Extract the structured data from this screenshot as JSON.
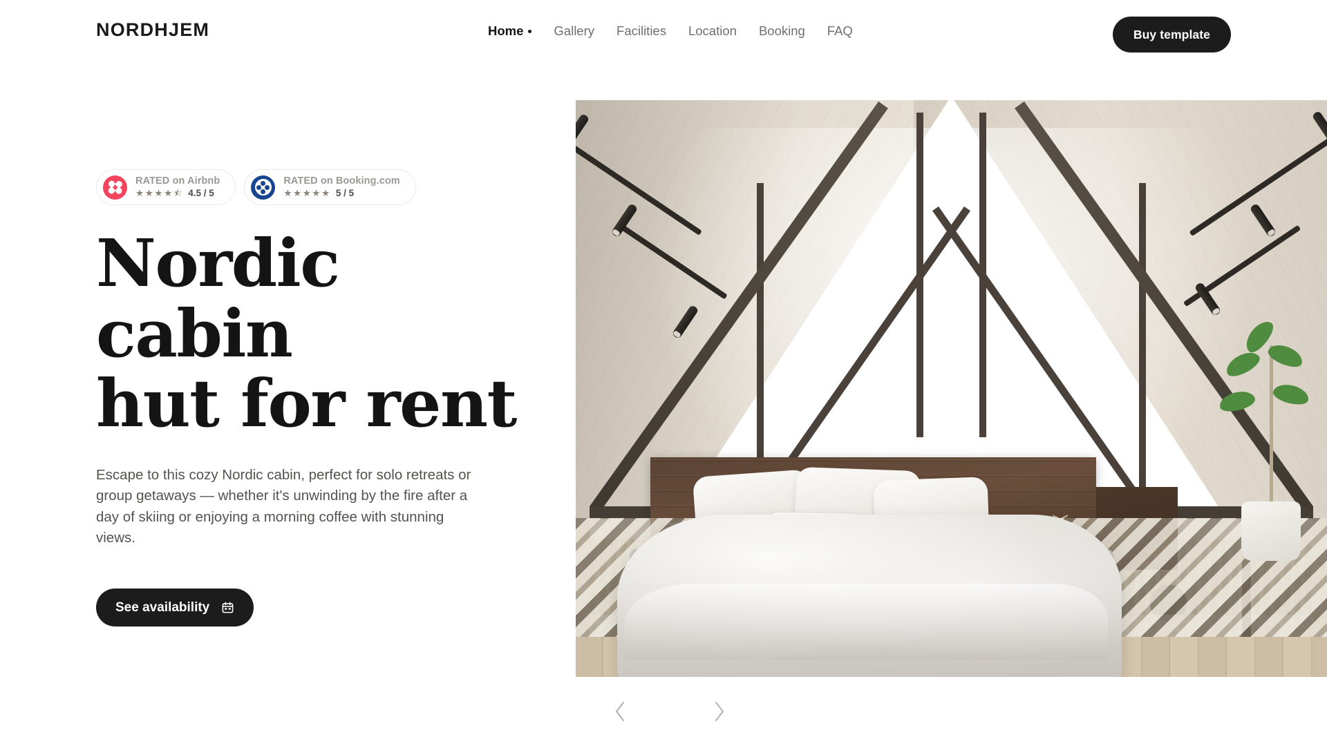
{
  "brand": {
    "name": "NORDHJEM"
  },
  "nav": {
    "items": [
      {
        "label": "Home",
        "active": true
      },
      {
        "label": "Gallery",
        "active": false
      },
      {
        "label": "Facilities",
        "active": false
      },
      {
        "label": "Location",
        "active": false
      },
      {
        "label": "Booking",
        "active": false
      },
      {
        "label": "FAQ",
        "active": false
      }
    ],
    "cta_label": "Buy template"
  },
  "hero": {
    "badges": [
      {
        "brand": "airbnb",
        "title": "RATED on Airbnb",
        "stars": "★★★★⯪",
        "score": "4.5 / 5"
      },
      {
        "brand": "booking",
        "title": "RATED on Booking.com",
        "stars": "★★★★★",
        "score": "5 / 5"
      }
    ],
    "headline_line1": "Nordic cabin",
    "headline_line2": "hut for rent",
    "paragraph": "Escape to this cozy Nordic cabin, perfect for solo retreats or group getaways — whether it's unwinding by the fire after a day of skiing or enjoying a morning coffee with stunning views.",
    "cta_label": "See availability",
    "image_alt": "A-frame Nordic cabin bedroom with floor-to-ceiling triangular windows overlooking a snowy forest"
  },
  "carousel": {
    "prev_label": "Previous image",
    "next_label": "Next image"
  },
  "colors": {
    "accent_dark": "#1c1c1c",
    "text_primary": "#141414",
    "text_muted": "#6f6f6f",
    "airbnb_red": "#f2445c",
    "booking_blue": "#18458f",
    "background": "#ffffff"
  }
}
